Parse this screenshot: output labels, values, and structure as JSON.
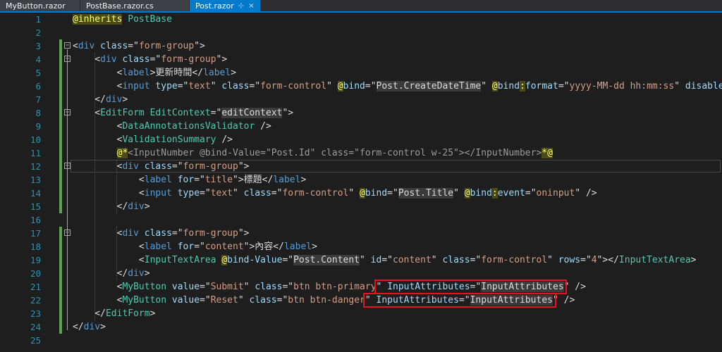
{
  "tabs": [
    {
      "label": "MyButton.razor",
      "active": false
    },
    {
      "label": "PostBase.razor.cs",
      "active": false
    },
    {
      "label": "Post.razor",
      "active": true,
      "pin": "⊹",
      "close": "×"
    }
  ],
  "lines": [
    {
      "n": "1",
      "tokens": [
        [
          "rh",
          "@inherits"
        ],
        [
          "p",
          " "
        ],
        [
          "c",
          "PostBase"
        ]
      ]
    },
    {
      "n": "2",
      "tokens": []
    },
    {
      "n": "3",
      "tokens": [
        [
          "p",
          "<"
        ],
        [
          "t",
          "div"
        ],
        [
          "p",
          " "
        ],
        [
          "a",
          "class"
        ],
        [
          "p",
          "=\""
        ],
        [
          "v",
          "form-group"
        ],
        [
          "p",
          "\">"
        ]
      ]
    },
    {
      "n": "4",
      "tokens": [
        [
          "p",
          "    <"
        ],
        [
          "t",
          "div"
        ],
        [
          "p",
          " "
        ],
        [
          "a",
          "class"
        ],
        [
          "p",
          "=\""
        ],
        [
          "v",
          "form-group"
        ],
        [
          "p",
          "\">"
        ]
      ]
    },
    {
      "n": "5",
      "tokens": [
        [
          "p",
          "        <"
        ],
        [
          "t",
          "label"
        ],
        [
          "p",
          ">更新時間</"
        ],
        [
          "t",
          "label"
        ],
        [
          "p",
          ">"
        ]
      ]
    },
    {
      "n": "6",
      "tokens": [
        [
          "p",
          "        <"
        ],
        [
          "t",
          "input"
        ],
        [
          "p",
          " "
        ],
        [
          "a",
          "type"
        ],
        [
          "p",
          "=\""
        ],
        [
          "v",
          "text"
        ],
        [
          "p",
          "\" "
        ],
        [
          "a",
          "class"
        ],
        [
          "p",
          "=\""
        ],
        [
          "v",
          "form-control"
        ],
        [
          "p",
          "\" "
        ],
        [
          "rh",
          "@"
        ],
        [
          "a",
          "bind"
        ],
        [
          "p",
          "=\""
        ],
        [
          "s",
          "Post.CreateDateTime"
        ],
        [
          "p",
          "\" "
        ],
        [
          "rh",
          "@"
        ],
        [
          "a",
          "bind"
        ],
        [
          "rh",
          ":"
        ],
        [
          "a",
          "format"
        ],
        [
          "p",
          "=\""
        ],
        [
          "v",
          "yyyy-MM-dd hh:mm:ss"
        ],
        [
          "p",
          "\" "
        ],
        [
          "a",
          "disabled"
        ],
        [
          "p",
          " />"
        ]
      ]
    },
    {
      "n": "7",
      "tokens": [
        [
          "p",
          "    </"
        ],
        [
          "t",
          "div"
        ],
        [
          "p",
          ">"
        ]
      ]
    },
    {
      "n": "8",
      "tokens": [
        [
          "p",
          "    <"
        ],
        [
          "c",
          "EditForm"
        ],
        [
          "p",
          " "
        ],
        [
          "c",
          "EditContext"
        ],
        [
          "p",
          "=\""
        ],
        [
          "s",
          "editContext"
        ],
        [
          "p",
          "\">"
        ]
      ]
    },
    {
      "n": "9",
      "tokens": [
        [
          "p",
          "        <"
        ],
        [
          "c",
          "DataAnnotationsValidator"
        ],
        [
          "p",
          " />"
        ]
      ]
    },
    {
      "n": "10",
      "tokens": [
        [
          "p",
          "        <"
        ],
        [
          "c",
          "ValidationSummary"
        ],
        [
          "p",
          " />"
        ]
      ]
    },
    {
      "n": "11",
      "tokens": [
        [
          "p",
          "        "
        ],
        [
          "rh",
          "@*"
        ],
        [
          "gray",
          "<InputNumber @bind-Value=\"Post.Id\" class=\"form-control w-25\"></InputNumber>"
        ],
        [
          "rh",
          "*@"
        ]
      ]
    },
    {
      "n": "12",
      "tokens": [
        [
          "p",
          "        <"
        ],
        [
          "t",
          "div"
        ],
        [
          "p",
          " "
        ],
        [
          "a",
          "class"
        ],
        [
          "p",
          "=\""
        ],
        [
          "v",
          "form-group"
        ],
        [
          "p",
          "\">"
        ]
      ]
    },
    {
      "n": "13",
      "tokens": [
        [
          "p",
          "            <"
        ],
        [
          "t",
          "label"
        ],
        [
          "p",
          " "
        ],
        [
          "a",
          "for"
        ],
        [
          "p",
          "=\""
        ],
        [
          "v",
          "title"
        ],
        [
          "p",
          "\">標題</"
        ],
        [
          "t",
          "label"
        ],
        [
          "p",
          ">"
        ]
      ]
    },
    {
      "n": "14",
      "tokens": [
        [
          "p",
          "            <"
        ],
        [
          "t",
          "input"
        ],
        [
          "p",
          " "
        ],
        [
          "a",
          "type"
        ],
        [
          "p",
          "=\""
        ],
        [
          "v",
          "text"
        ],
        [
          "p",
          "\" "
        ],
        [
          "a",
          "class"
        ],
        [
          "p",
          "=\""
        ],
        [
          "v",
          "form-control"
        ],
        [
          "p",
          "\" "
        ],
        [
          "rh",
          "@"
        ],
        [
          "a",
          "bind"
        ],
        [
          "p",
          "=\""
        ],
        [
          "s",
          "Post.Title"
        ],
        [
          "p",
          "\" "
        ],
        [
          "rh",
          "@"
        ],
        [
          "a",
          "bind"
        ],
        [
          "rh",
          ":"
        ],
        [
          "a",
          "event"
        ],
        [
          "p",
          "=\""
        ],
        [
          "v",
          "oninput"
        ],
        [
          "p",
          "\" />"
        ]
      ]
    },
    {
      "n": "15",
      "tokens": [
        [
          "p",
          "        </"
        ],
        [
          "t",
          "div"
        ],
        [
          "p",
          ">"
        ]
      ]
    },
    {
      "n": "16",
      "tokens": []
    },
    {
      "n": "17",
      "tokens": [
        [
          "p",
          "        <"
        ],
        [
          "t",
          "div"
        ],
        [
          "p",
          " "
        ],
        [
          "a",
          "class"
        ],
        [
          "p",
          "=\""
        ],
        [
          "v",
          "form-group"
        ],
        [
          "p",
          "\">"
        ]
      ]
    },
    {
      "n": "18",
      "tokens": [
        [
          "p",
          "            <"
        ],
        [
          "t",
          "label"
        ],
        [
          "p",
          " "
        ],
        [
          "a",
          "for"
        ],
        [
          "p",
          "=\""
        ],
        [
          "v",
          "content"
        ],
        [
          "p",
          "\">內容</"
        ],
        [
          "t",
          "label"
        ],
        [
          "p",
          ">"
        ]
      ]
    },
    {
      "n": "19",
      "tokens": [
        [
          "p",
          "            <"
        ],
        [
          "c",
          "InputTextArea"
        ],
        [
          "p",
          " "
        ],
        [
          "rh",
          "@"
        ],
        [
          "a",
          "bind-Value"
        ],
        [
          "p",
          "=\""
        ],
        [
          "s",
          "Post.Content"
        ],
        [
          "p",
          "\" "
        ],
        [
          "a",
          "id"
        ],
        [
          "p",
          "=\""
        ],
        [
          "v",
          "content"
        ],
        [
          "p",
          "\" "
        ],
        [
          "a",
          "class"
        ],
        [
          "p",
          "=\""
        ],
        [
          "v",
          "form-control"
        ],
        [
          "p",
          "\" "
        ],
        [
          "a",
          "rows"
        ],
        [
          "p",
          "=\""
        ],
        [
          "v",
          "4"
        ],
        [
          "p",
          "\"></"
        ],
        [
          "c",
          "InputTextArea"
        ],
        [
          "p",
          ">"
        ]
      ]
    },
    {
      "n": "20",
      "tokens": [
        [
          "p",
          "        </"
        ],
        [
          "t",
          "div"
        ],
        [
          "p",
          ">"
        ]
      ]
    },
    {
      "n": "21",
      "tokens": [
        [
          "p",
          "        <"
        ],
        [
          "c",
          "MyButton"
        ],
        [
          "p",
          " "
        ],
        [
          "a",
          "value"
        ],
        [
          "p",
          "=\""
        ],
        [
          "v",
          "Submit"
        ],
        [
          "p",
          "\" "
        ],
        [
          "a",
          "class"
        ],
        [
          "p",
          "=\""
        ],
        [
          "v",
          "btn btn-primary"
        ],
        [
          "p",
          "\" "
        ],
        [
          "a",
          "InputAttributes"
        ],
        [
          "p",
          "=\""
        ],
        [
          "s",
          "InputAttributes"
        ],
        [
          "p",
          "\" />"
        ]
      ]
    },
    {
      "n": "22",
      "tokens": [
        [
          "p",
          "        <"
        ],
        [
          "c",
          "MyButton"
        ],
        [
          "p",
          " "
        ],
        [
          "a",
          "value"
        ],
        [
          "p",
          "=\""
        ],
        [
          "v",
          "Reset"
        ],
        [
          "p",
          "\" "
        ],
        [
          "a",
          "class"
        ],
        [
          "p",
          "=\""
        ],
        [
          "v",
          "btn btn-danger"
        ],
        [
          "p",
          "\" "
        ],
        [
          "a",
          "InputAttributes"
        ],
        [
          "p",
          "=\""
        ],
        [
          "s",
          "InputAttributes"
        ],
        [
          "p",
          "\" />"
        ]
      ]
    },
    {
      "n": "23",
      "tokens": [
        [
          "p",
          "    </"
        ],
        [
          "c",
          "EditForm"
        ],
        [
          "p",
          ">"
        ]
      ]
    },
    {
      "n": "24",
      "tokens": [
        [
          "p",
          "</"
        ],
        [
          "t",
          "div"
        ],
        [
          "p",
          ">"
        ]
      ]
    },
    {
      "n": "25",
      "tokens": []
    }
  ],
  "colors": {
    "background": "#1e1e1e",
    "tab_active": "#007acc",
    "line_number": "#2b91af",
    "change_marker": "#57a64a",
    "highlight_box": "#e81123"
  }
}
